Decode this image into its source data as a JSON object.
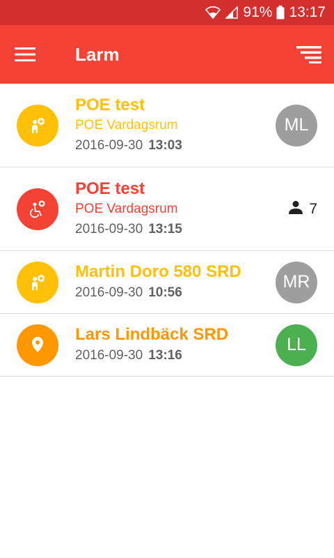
{
  "status_bar": {
    "battery_percent": "91%",
    "time": "13:17"
  },
  "app_bar": {
    "title": "Larm",
    "menu_icon": "hamburger-menu-icon",
    "sort_icon": "sort-icon"
  },
  "colors": {
    "status_bar": "#d32f2f",
    "app_bar": "#f44336",
    "yellow": "#ffc107",
    "red": "#f44336",
    "orange": "#ff9800",
    "avatar_grey": "#9e9e9e",
    "avatar_green": "#4caf50"
  },
  "alarms": [
    {
      "name": "POE test",
      "location": "POE Vardagsrum",
      "date": "2016-09-30",
      "time": "13:03",
      "icon": "person-assistance-icon",
      "color": "yellow",
      "assignee": "ML"
    },
    {
      "name": "POE test",
      "location": "POE Vardagsrum",
      "date": "2016-09-30",
      "time": "13:15",
      "icon": "wheelchair-icon",
      "color": "red",
      "responders": "7"
    },
    {
      "name": "Martin Doro 580 SRD",
      "date": "2016-09-30",
      "time": "10:56",
      "icon": "person-assistance-icon",
      "color": "yellow",
      "assignee": "MR"
    },
    {
      "name": "Lars Lindbäck SRD",
      "date": "2016-09-30",
      "time": "13:16",
      "icon": "location-pin-icon",
      "color": "orange",
      "assignee": "LL"
    }
  ]
}
